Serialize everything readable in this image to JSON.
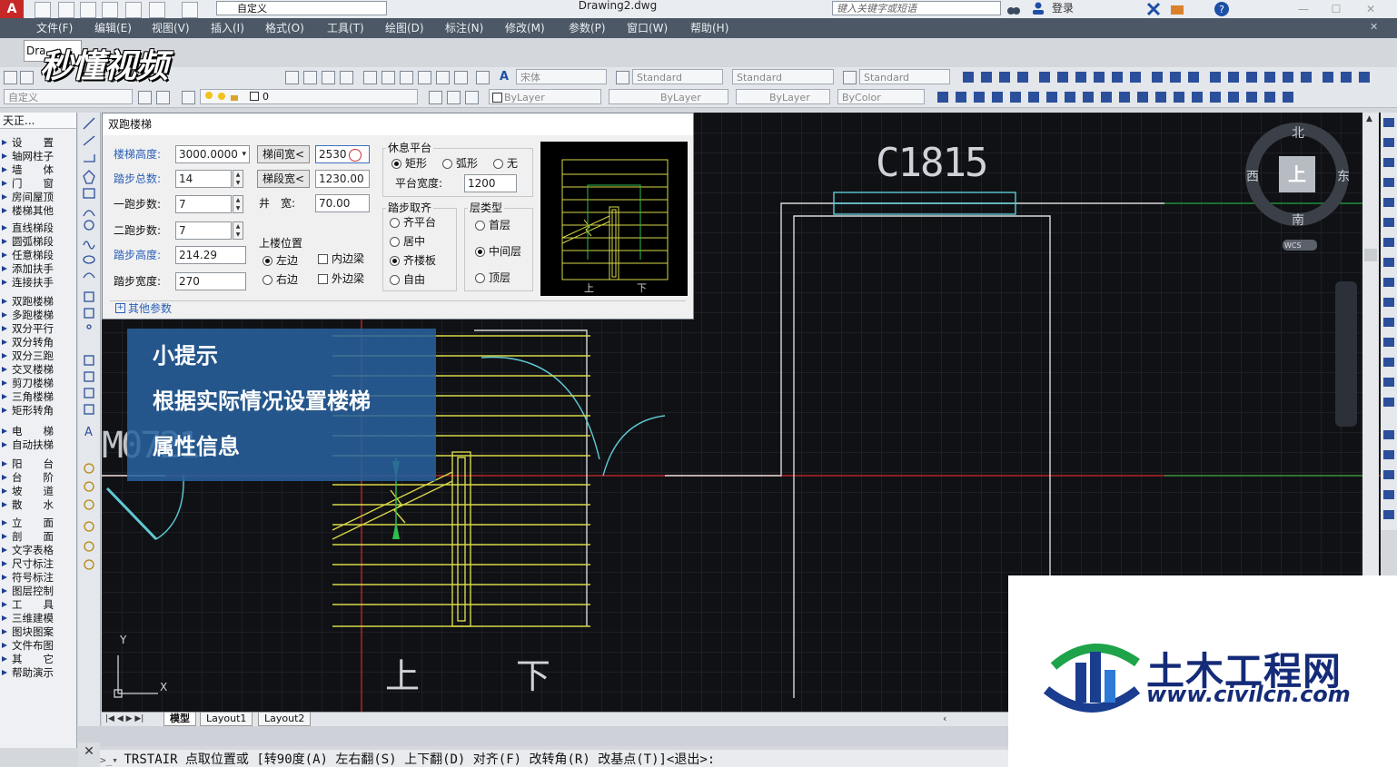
{
  "watermark": {
    "brand": "秒懂视频"
  },
  "title_bar": {
    "workspace": "自定义",
    "document_title": "Drawing2.dwg",
    "search_placeholder": "键入关键字或短语",
    "login_label": "登录"
  },
  "menu": [
    "文件(F)",
    "编辑(E)",
    "视图(V)",
    "插入(I)",
    "格式(O)",
    "工具(T)",
    "绘图(D)",
    "标注(N)",
    "修改(M)",
    "参数(P)",
    "窗口(W)",
    "帮助(H)"
  ],
  "doc_tab": "Dra",
  "toolbar": {
    "font_style": "宋体",
    "text_style": "Standard",
    "dim_style": "Standard",
    "table_style": "Standard",
    "ucs_combo": "自定义",
    "layer_value": "0",
    "color": "ByLayer",
    "linetype": "ByLayer",
    "lineweight": "ByLayer",
    "plotstyle": "ByColor"
  },
  "left_panel": {
    "title": "天正...",
    "items": [
      "设　　置",
      "轴网柱子",
      "墙　　体",
      "门　　窗",
      "房间屋顶",
      "楼梯其他",
      "直线梯段",
      "圆弧梯段",
      "任意梯段",
      "添加扶手",
      "连接扶手",
      "双跑楼梯",
      "多跑楼梯",
      "双分平行",
      "双分转角",
      "双分三跑",
      "交叉楼梯",
      "剪刀楼梯",
      "三角楼梯",
      "矩形转角",
      "电　　梯",
      "自动扶梯",
      "阳　　台",
      "台　　阶",
      "坡　　道",
      "散　　水",
      "立　　面",
      "剖　　面",
      "文字表格",
      "尺寸标注",
      "符号标注",
      "图层控制",
      "工　　具",
      "三维建模",
      "图块图案",
      "文件布图",
      "其　　它",
      "帮助演示"
    ]
  },
  "dialog": {
    "title": "双跑楼梯",
    "stair_height": {
      "label": "楼梯高度:",
      "value": "3000.0000"
    },
    "total_steps": {
      "label": "踏步总数:",
      "value": "14"
    },
    "first_flight": {
      "label": "一跑步数:",
      "value": "7"
    },
    "second_flight": {
      "label": "二跑步数:",
      "value": "7"
    },
    "step_height": {
      "label": "踏步高度:",
      "value": "214.29"
    },
    "step_width": {
      "label": "踏步宽度:",
      "value": "270"
    },
    "room_width_btn": "梯间宽<",
    "room_width_value": "2530",
    "flight_width_btn": "梯段宽<",
    "flight_width_value": "1230.00",
    "well_label": "井　宽:",
    "well_value": "70.00",
    "upstairs_group": "上楼位置",
    "up_left": "左边",
    "up_right": "右边",
    "inner_beam": "内边梁",
    "outer_beam": "外边梁",
    "landing_group": "休息平台",
    "landing_rect": "矩形",
    "landing_arc": "弧形",
    "landing_none": "无",
    "landing_width_label": "平台宽度:",
    "landing_width_value": "1200",
    "align_group": "踏步取齐",
    "align_landing": "齐平台",
    "align_center": "居中",
    "align_slab": "齐楼板",
    "align_free": "自由",
    "floor_group": "层类型",
    "floor_first": "首层",
    "floor_middle": "中间层",
    "floor_top": "顶层",
    "more_params": "其他参数",
    "preview_up": "上",
    "preview_down": "下"
  },
  "tip": {
    "line1": "小提示",
    "line2": "根据实际情况设置楼梯",
    "line3": "属性信息"
  },
  "drawing": {
    "window_tag": "C1815",
    "door_tag": "M0721",
    "up_text": "上",
    "down_text": "下"
  },
  "view_cube": {
    "north": "北",
    "south": "南",
    "east": "东",
    "west": "西",
    "top": "上",
    "wcs": "WCS"
  },
  "ucs": {
    "x": "X",
    "y": "Y"
  },
  "layout_tabs": [
    "模型",
    "Layout1",
    "Layout2"
  ],
  "command_line": "TRSTAIR 点取位置或 [转90度(A) 左右翻(S) 上下翻(D) 对齐(F) 改转角(R) 改基点(T)]<退出>:",
  "corner_logo": {
    "name": "土木工程网",
    "url": "www.civilcn.com"
  }
}
